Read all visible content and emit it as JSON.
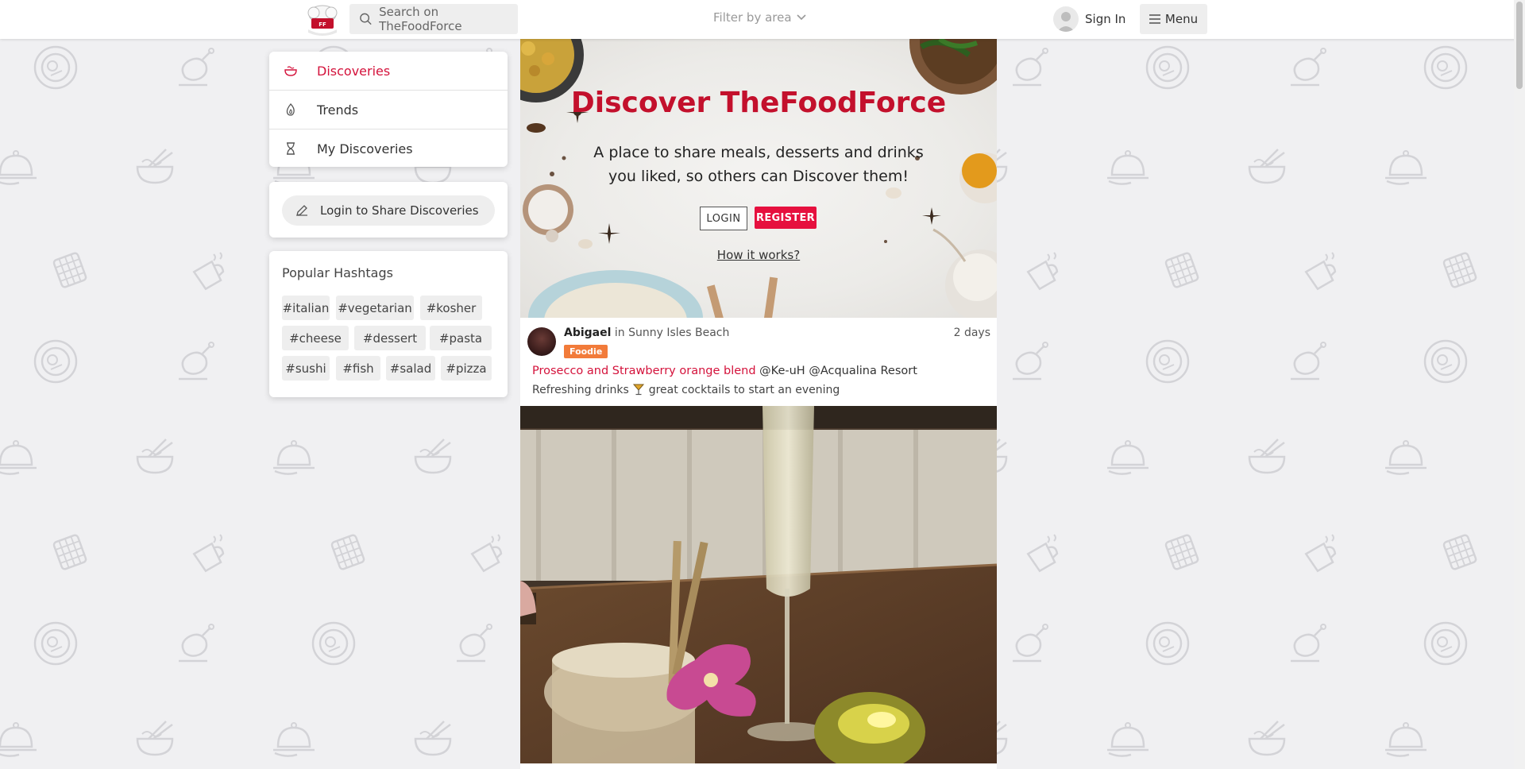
{
  "header": {
    "search_placeholder": "Search on TheFoodForce",
    "filter_label": "Filter by area",
    "signin_label": "Sign In",
    "menu_label": "Menu"
  },
  "sidebar": {
    "nav": [
      {
        "label": "Discoveries",
        "icon": "bowl-icon",
        "active": true
      },
      {
        "label": "Trends",
        "icon": "flame-icon",
        "active": false
      },
      {
        "label": "My Discoveries",
        "icon": "hourglass-icon",
        "active": false
      }
    ],
    "share_label": "Login to Share Discoveries",
    "hashtags_title": "Popular Hashtags",
    "hashtags": [
      "#italian",
      "#vegetarian",
      "#kosher",
      "#cheese",
      "#dessert",
      "#pasta",
      "#sushi",
      "#fish",
      "#salad",
      "#pizza"
    ]
  },
  "hero": {
    "title": "Discover TheFoodForce",
    "subtitle": "A place to share meals, desserts and drinks you liked, so others can Discover them!",
    "login_label": "LOGIN",
    "register_label": "REGISTER",
    "how_label": "How it works?"
  },
  "post": {
    "user": "Abigael",
    "location_prefix": "in",
    "location": "Sunny Isles Beach",
    "badge": "Foodie",
    "time": "2 days",
    "dish": "Prosecco and Strawberry orange blend",
    "mention1": "@Ke-uH",
    "mention2": "@Acqualina Resort",
    "desc_before": "Refreshing drinks",
    "desc_after": "great cocktails to start an evening"
  },
  "colors": {
    "brand_red": "#c3102c",
    "accent_red": "#d4123b",
    "register_bg": "#e6103e",
    "badge_orange": "#f27b3a"
  }
}
